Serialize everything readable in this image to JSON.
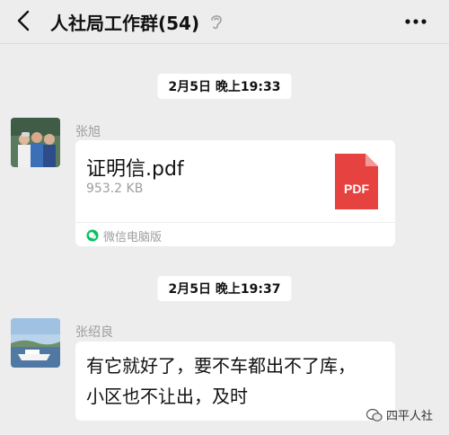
{
  "header": {
    "title": "人社局工作群(54)",
    "mute_icon": "ear-mute-icon",
    "back_icon": "chevron-left-icon",
    "more_icon": "more-dots-icon"
  },
  "messages": [
    {
      "time": "2月5日 晚上19:33",
      "sender": "张旭",
      "file": {
        "name": "证明信.pdf",
        "size": "953.2 KB",
        "type_label": "PDF",
        "source": "微信电脑版"
      }
    },
    {
      "time": "2月5日 晚上19:37",
      "sender": "张绍良",
      "text_lines": [
        "有它就好了，要不车都出不了库，",
        "小区也不让出，及时"
      ]
    }
  ],
  "watermark": "四平人社",
  "colors": {
    "background": "#ededed",
    "pdf_red": "#e64340",
    "wechat_green": "#07c160"
  }
}
